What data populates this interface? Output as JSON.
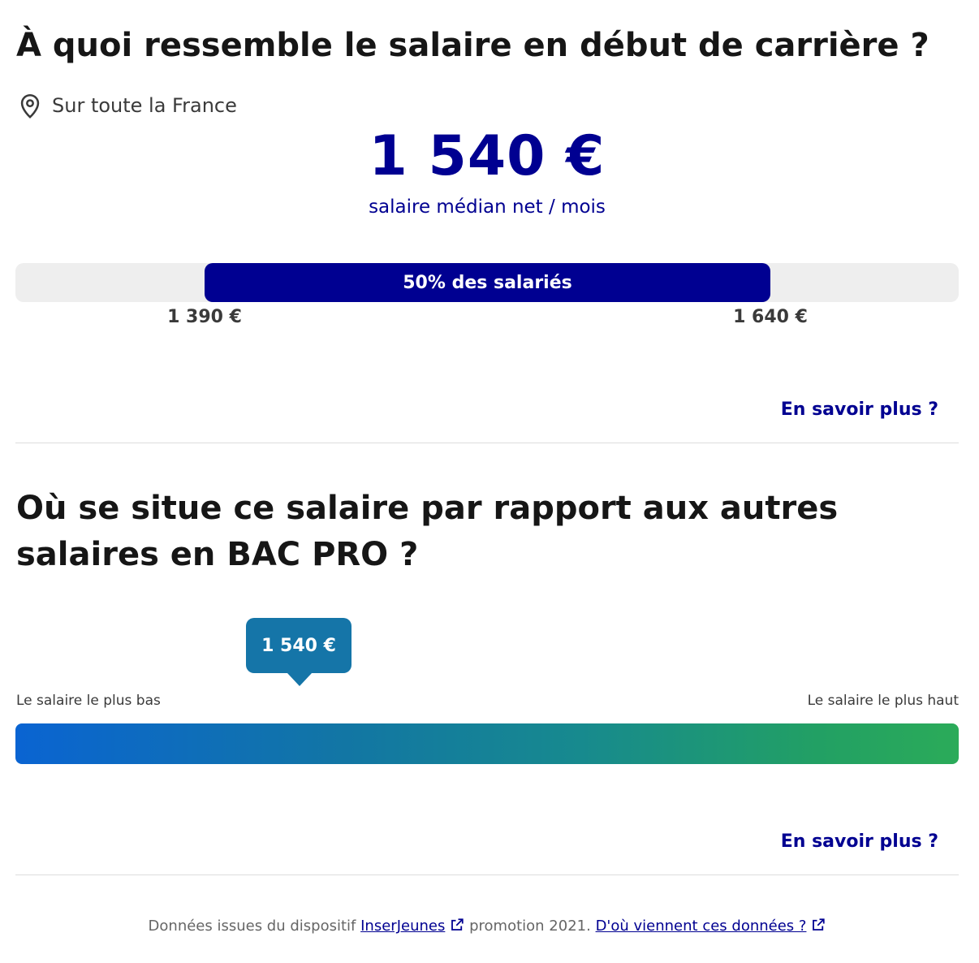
{
  "section1": {
    "title": "À quoi ressemble le salaire en début de carrière ?",
    "location": "Sur toute la France",
    "median_value": "1 540 €",
    "median_label": "salaire médian net / mois",
    "range": {
      "label": "50% des salariés",
      "low": "1 390 €",
      "high": "1 640 €",
      "fill_start_fraction": 0.2,
      "fill_end_fraction": 0.8
    },
    "more_link": "En savoir plus ?"
  },
  "section2": {
    "title": "Où se situe ce salaire par rapport aux autres salaires en BAC PRO ?",
    "tooltip_value": "1 540 €",
    "scale_low_label": "Le salaire le plus bas",
    "scale_high_label": "Le salaire le plus haut",
    "marker_position_fraction": 0.3,
    "gradient_colors": [
      "#0a64d2",
      "#1276a4",
      "#178a8e",
      "#22a064",
      "#2bab59"
    ],
    "more_link": "En savoir plus ?"
  },
  "footer": {
    "prefix": "Données issues du dispositif",
    "link1": "InserJeunes",
    "middle": "promotion 2021.",
    "link2": "D'où viennent ces données ?"
  },
  "colors": {
    "primary": "#000091",
    "tooltip": "#1575a8",
    "track": "#eeeeee"
  },
  "icons": {
    "location": "map-pin-icon",
    "external": "external-link-icon"
  }
}
